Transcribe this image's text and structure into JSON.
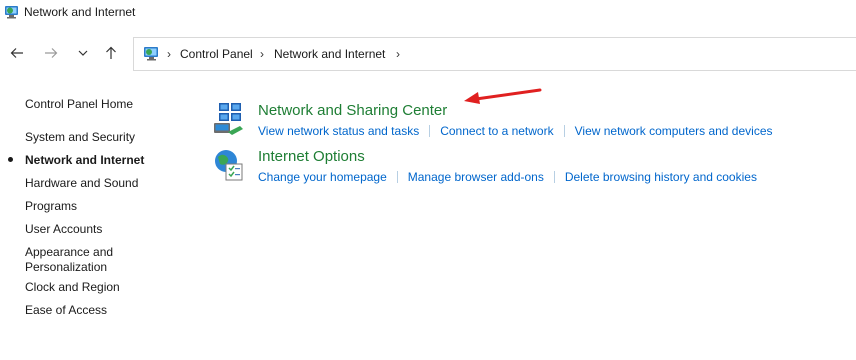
{
  "window": {
    "title": "Network and Internet"
  },
  "navigation": {
    "breadcrumbs": [
      "Control Panel",
      "Network and Internet"
    ]
  },
  "sidebar": {
    "home_label": "Control Panel Home",
    "items": [
      {
        "label": "System and Security",
        "active": false
      },
      {
        "label": "Network and Internet",
        "active": true
      },
      {
        "label": "Hardware and Sound",
        "active": false
      },
      {
        "label": "Programs",
        "active": false
      },
      {
        "label": "User Accounts",
        "active": false
      },
      {
        "label": "Appearance and Personalization",
        "active": false
      },
      {
        "label": "Clock and Region",
        "active": false
      },
      {
        "label": "Ease of Access",
        "active": false
      }
    ]
  },
  "main": {
    "categories": [
      {
        "title": "Network and Sharing Center",
        "icon": "network-sharing-icon",
        "links": [
          "View network status and tasks",
          "Connect to a network",
          "View network computers and devices"
        ]
      },
      {
        "title": "Internet Options",
        "icon": "internet-options-icon",
        "links": [
          "Change your homepage",
          "Manage browser add-ons",
          "Delete browsing history and cookies"
        ]
      }
    ]
  },
  "colors": {
    "category_title": "#1e7e34",
    "link": "#0066cc",
    "annotation_arrow": "#e02020"
  }
}
